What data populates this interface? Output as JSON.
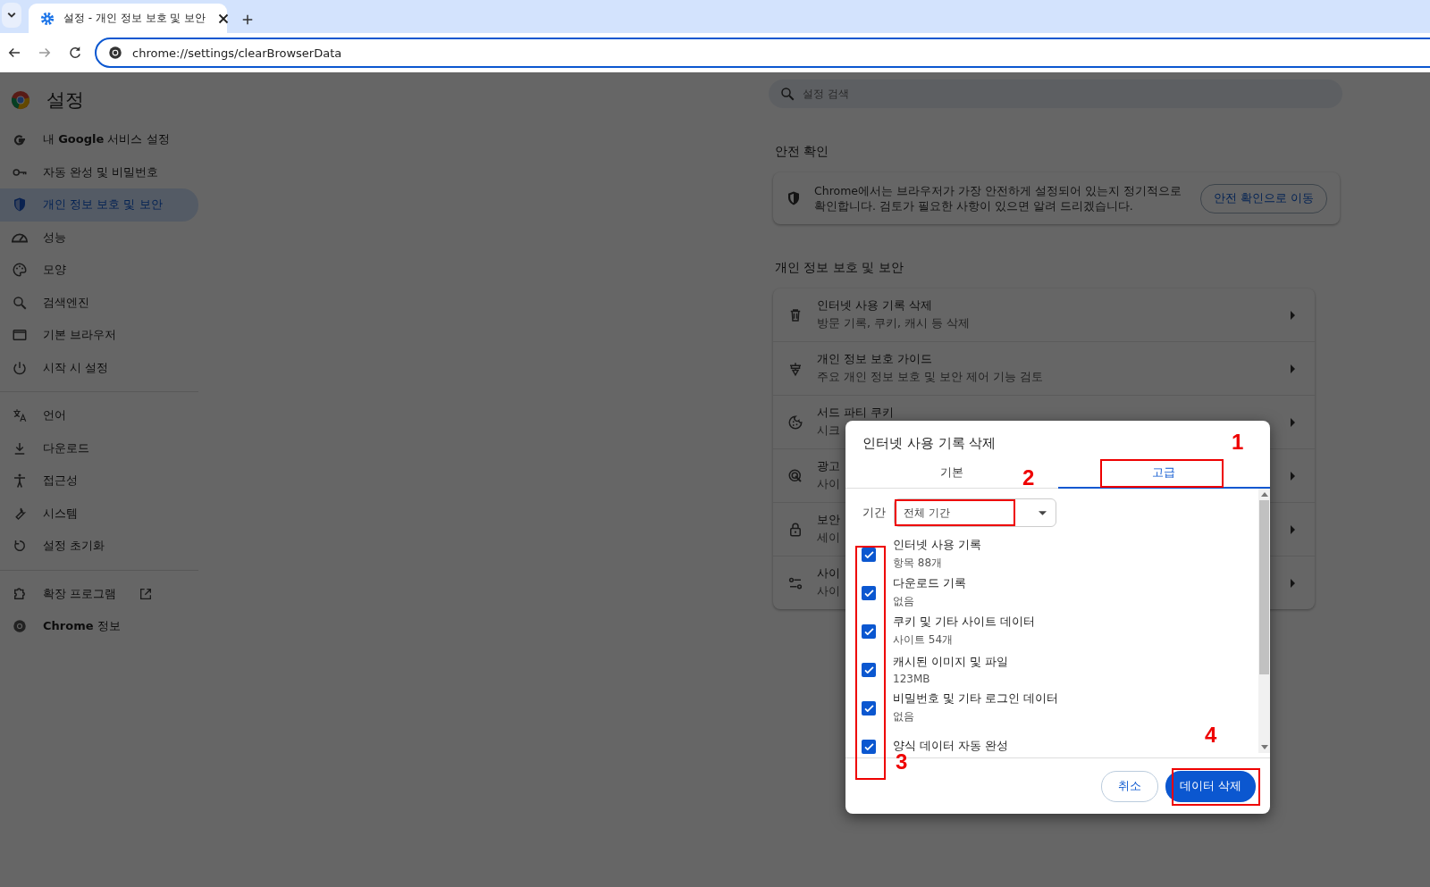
{
  "browser": {
    "tab_title": "설정 - 개인 정보 보호 및 보안",
    "url": "chrome://settings/clearBrowserData"
  },
  "settings": {
    "title": "설정",
    "search": {
      "placeholder": "설정 검색"
    },
    "sidebar": {
      "groups": [
        [
          {
            "label": "내 **Google** 서비스 설정",
            "selected": false
          },
          {
            "label": "자동 완성 및 비밀번호",
            "selected": false
          },
          {
            "label": "개인 정보 보호 및 보안",
            "selected": true
          },
          {
            "label": "성능",
            "selected": false
          },
          {
            "label": "모양",
            "selected": false
          },
          {
            "label": "검색엔진",
            "selected": false
          },
          {
            "label": "기본 브라우저",
            "selected": false
          },
          {
            "label": "시작 시 설정",
            "selected": false
          }
        ],
        [
          {
            "label": "언어",
            "selected": false
          },
          {
            "label": "다운로드",
            "selected": false
          },
          {
            "label": "접근성",
            "selected": false
          },
          {
            "label": "시스템",
            "selected": false
          },
          {
            "label": "설정 초기화",
            "selected": false
          }
        ],
        [
          {
            "label": "확장 프로그램",
            "selected": false,
            "external": true
          },
          {
            "label": "**Chrome** 정보",
            "selected": false
          }
        ]
      ]
    },
    "safety_check": {
      "heading": "안전 확인",
      "text": "Chrome에서는 브라우저가 가장 안전하게 설정되어 있는지 정기적으로 확인합니다. 검토가 필요한 사항이 있으면 알려 드리겠습니다.",
      "button": "안전 확인으로 이동"
    },
    "privacy": {
      "heading": "개인 정보 보호 및 보안",
      "rows": [
        {
          "title": "인터넷 사용 기록 삭제",
          "subtitle": "방문 기록, 쿠키, 캐시 등 삭제"
        },
        {
          "title": "개인 정보 보호 가이드",
          "subtitle": "주요 개인 정보 보호 및 보안 제어 기능 검토"
        },
        {
          "title": "서드 파티 쿠키",
          "subtitle": "시크"
        },
        {
          "title": "광고",
          "subtitle": "사이"
        },
        {
          "title": "보안",
          "subtitle": "세이"
        },
        {
          "title": "사이",
          "subtitle": "사이"
        }
      ]
    }
  },
  "dialog": {
    "title": "인터넷 사용 기록 삭제",
    "tabs": [
      {
        "label": "기본",
        "selected": false
      },
      {
        "label": "고급",
        "selected": true
      }
    ],
    "period": {
      "label": "기간",
      "value": "전체 기간"
    },
    "items": [
      {
        "label": "인터넷 사용 기록",
        "detail": "항목 88개",
        "checked": true
      },
      {
        "label": "다운로드 기록",
        "detail": "없음",
        "checked": true
      },
      {
        "label": "쿠키 및 기타 사이트 데이터",
        "detail": "사이트 54개",
        "checked": true
      },
      {
        "label": "캐시된 이미지 및 파일",
        "detail": "123MB",
        "checked": true
      },
      {
        "label": "비밀번호 및 기타 로그인 데이터",
        "detail": "없음",
        "checked": true
      },
      {
        "label": "양식 데이터 자동 완성",
        "checked": true
      }
    ],
    "cancel": "취소",
    "confirm": "데이터 삭제"
  },
  "annotations": [
    {
      "number": "1"
    },
    {
      "number": "2"
    },
    {
      "number": "3"
    },
    {
      "number": "4"
    }
  ]
}
